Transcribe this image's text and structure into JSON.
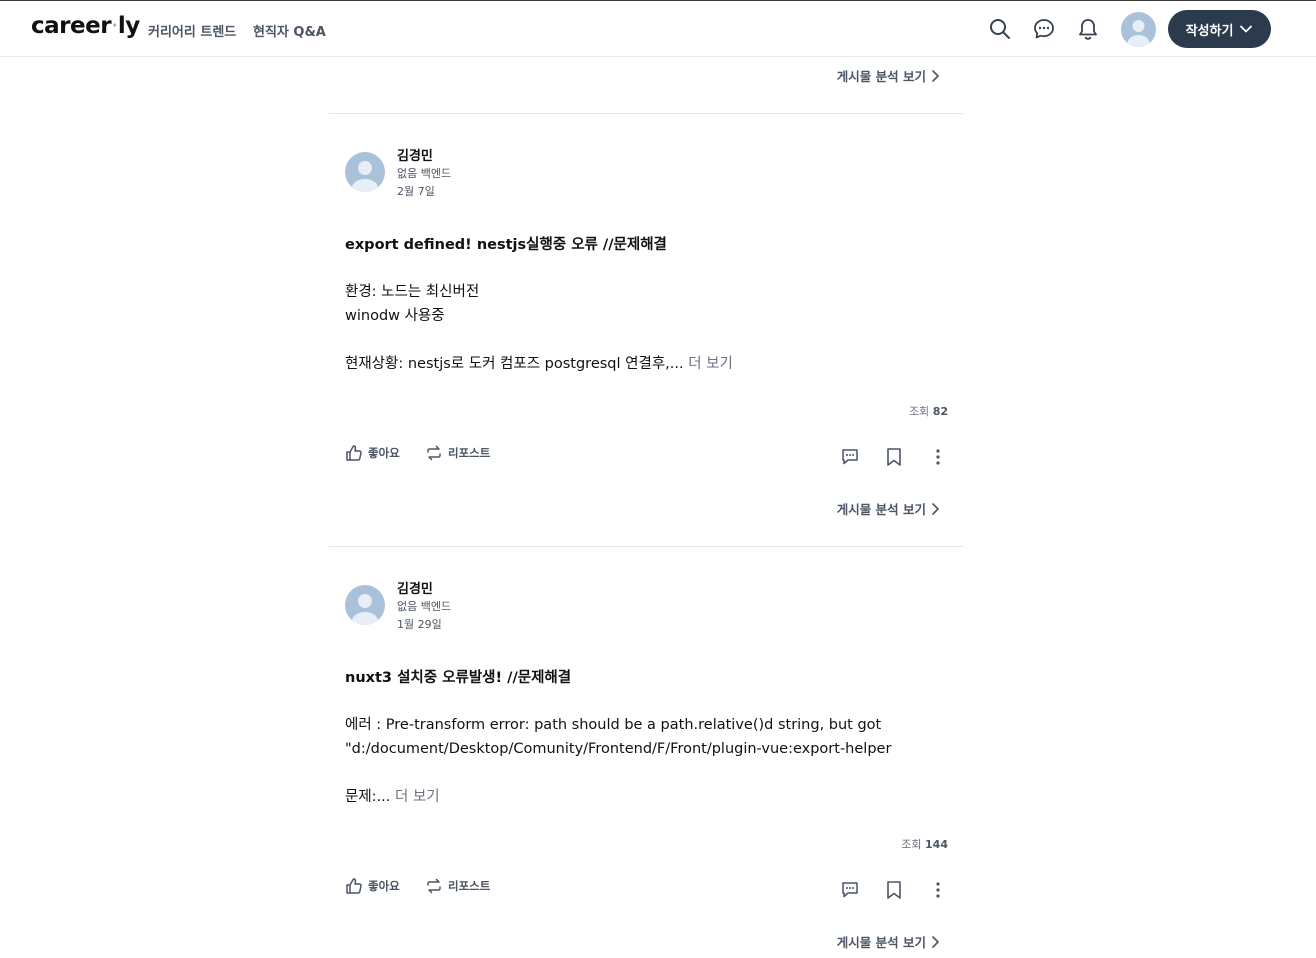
{
  "header": {
    "logo_main": "career",
    "logo_dot": "·",
    "logo_end": "ly",
    "nav": [
      "커리어리 트렌드",
      "현직자 Q&A"
    ],
    "write_button": "작성하기"
  },
  "top_analysis": "게시물 분석 보기",
  "posts": [
    {
      "author": "김경민",
      "job": "없음 백엔드",
      "date": "2월 7일",
      "title": "export defined! nestjs실행중 오류 //문제해결",
      "lines": [
        "환경: 노드는 최신버전",
        "winodw 사용중",
        "",
        "현재상황: nestjs로 도커 컴포즈 postgresql 연결후,... "
      ],
      "more": "더 보기",
      "views_label": "조회",
      "views": "82",
      "like": "좋아요",
      "repost": "리포스트",
      "analysis": "게시물 분석 보기"
    },
    {
      "author": "김경민",
      "job": "없음 백엔드",
      "date": "1월 29일",
      "title": "nuxt3 설치중 오류발생! //문제해결",
      "lines": [
        "에러 : Pre-transform error: path should be a path.relative()d string, but got",
        "\"d:/document/Desktop/Comunity/Frontend/F/Front/plugin-vue:export-helper",
        "",
        "문제:... "
      ],
      "more": "더 보기",
      "views_label": "조회",
      "views": "144",
      "like": "좋아요",
      "repost": "리포스트",
      "analysis": "게시물 분석 보기"
    }
  ],
  "colors": {
    "accent_button": "#2b3a4d",
    "avatar": "#a9c2da"
  }
}
